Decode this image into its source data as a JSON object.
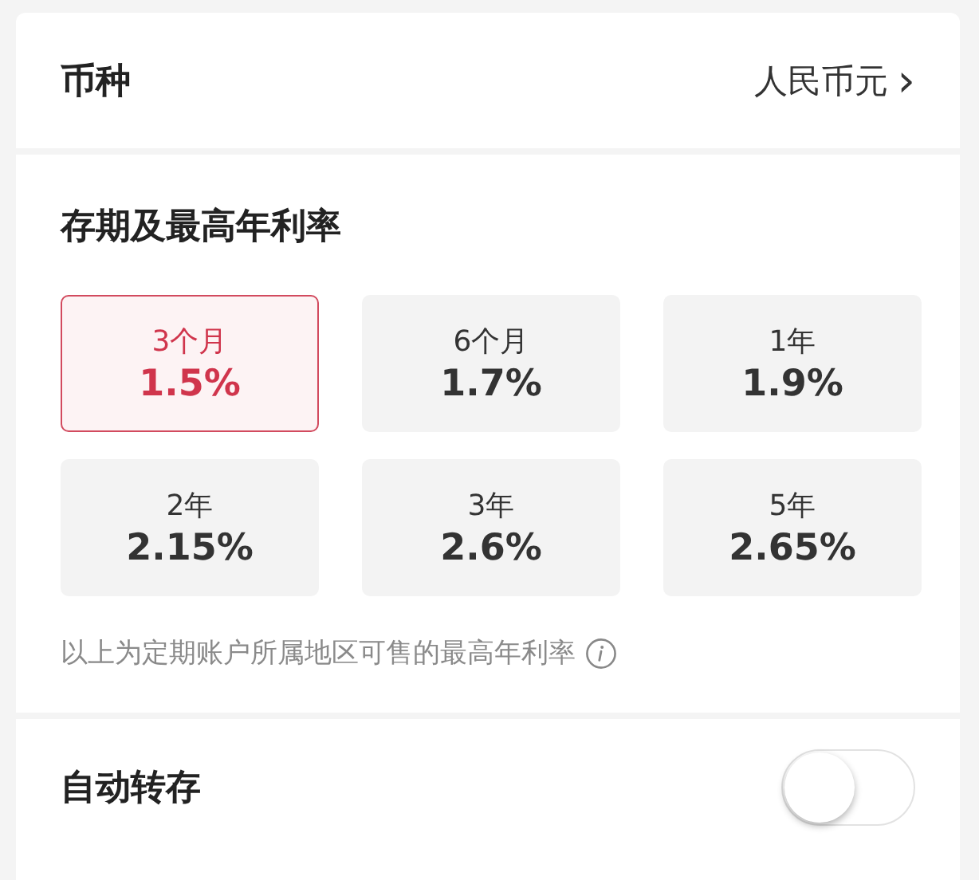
{
  "currency": {
    "label": "币种",
    "value": "人民币元",
    "chevron": "›"
  },
  "terms": {
    "title": "存期及最高年利率",
    "options": [
      {
        "term": "3个月",
        "rate": "1.5%",
        "selected": true
      },
      {
        "term": "6个月",
        "rate": "1.7%",
        "selected": false
      },
      {
        "term": "1年",
        "rate": "1.9%",
        "selected": false
      },
      {
        "term": "2年",
        "rate": "2.15%",
        "selected": false
      },
      {
        "term": "3年",
        "rate": "2.6%",
        "selected": false
      },
      {
        "term": "5年",
        "rate": "2.65%",
        "selected": false
      }
    ],
    "note": "以上为定期账户所属地区可售的最高年利率"
  },
  "auto_renew": {
    "label": "自动转存",
    "on": false
  }
}
